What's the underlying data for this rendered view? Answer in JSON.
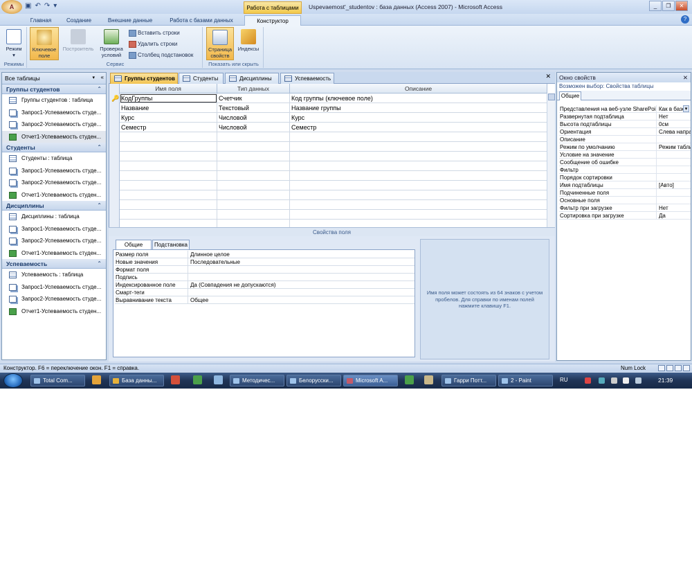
{
  "window": {
    "app_logo": "A",
    "title": "Uspevaemost'_studentov : база данных (Access 2007) - Microsoft Access",
    "context_tab": "Работа с таблицами",
    "buttons": [
      "_",
      "❐",
      "✕"
    ]
  },
  "ribbon_tabs": [
    "Главная",
    "Создание",
    "Внешние данные",
    "Работа с базами данных",
    "Конструктор"
  ],
  "ribbon": {
    "groups": {
      "modes": "Режимы",
      "service": "Сервис",
      "show_hide": "Показать или скрыть"
    },
    "mode_button": "Режим",
    "mode_arrow": "▾",
    "key_field": "Ключевое поле",
    "builder": "Построитель",
    "check_conditions": "Проверка условий",
    "insert_rows": "Вставить строки",
    "delete_rows": "Удалить строки",
    "lookup_column": "Столбец подстановок",
    "property_sheet": "Страница свойств",
    "indexes": "Индексы"
  },
  "nav": {
    "header": "Все таблицы",
    "groups": [
      {
        "title": "Группы студентов",
        "items": [
          {
            "label": "Группы студентов : таблица",
            "type": "table"
          },
          {
            "label": "Запрос1-Успеваемость студе...",
            "type": "query"
          },
          {
            "label": "Запрос2-Успеваемость студе...",
            "type": "query"
          },
          {
            "label": "Отчет1-Успеваемость студен...",
            "type": "report"
          }
        ]
      },
      {
        "title": "Студенты",
        "items": [
          {
            "label": "Студенты : таблица",
            "type": "table"
          },
          {
            "label": "Запрос1-Успеваемость студе...",
            "type": "query"
          },
          {
            "label": "Запрос2-Успеваемость студе...",
            "type": "query"
          },
          {
            "label": "Отчет1-Успеваемость студен...",
            "type": "report"
          }
        ]
      },
      {
        "title": "Дисциплины",
        "items": [
          {
            "label": "Дисциплины : таблица",
            "type": "table"
          },
          {
            "label": "Запрос1-Успеваемость студе...",
            "type": "query"
          },
          {
            "label": "Запрос2-Успеваемость студе...",
            "type": "query"
          },
          {
            "label": "Отчет1-Успеваемость студен...",
            "type": "report"
          }
        ]
      },
      {
        "title": "Успеваемость",
        "items": [
          {
            "label": "Успеваемость : таблица",
            "type": "table"
          },
          {
            "label": "Запрос1-Успеваемость студе...",
            "type": "query"
          },
          {
            "label": "Запрос2-Успеваемость студе...",
            "type": "query"
          },
          {
            "label": "Отчет1-Успеваемость студен...",
            "type": "report"
          }
        ]
      }
    ]
  },
  "doc_tabs": [
    "Группы студентов",
    "Студенты",
    "Дисциплины",
    "Успеваемость"
  ],
  "design_grid": {
    "headers": [
      "Имя поля",
      "Тип данных",
      "Описание"
    ],
    "rows": [
      [
        "КодГруппы",
        "Счетчик",
        "Код группы (ключевое поле)"
      ],
      [
        "Название",
        "Текстовый",
        "Название группы"
      ],
      [
        "Курс",
        "Числовой",
        "Курс"
      ],
      [
        "Семестр",
        "Числовой",
        "Семестр"
      ]
    ]
  },
  "field_props": {
    "section_title": "Свойства поля",
    "tabs": [
      "Общие",
      "Подстановка"
    ],
    "rows": [
      [
        "Размер поля",
        "Длинное целое"
      ],
      [
        "Новые значения",
        "Последовательные"
      ],
      [
        "Формат поля",
        ""
      ],
      [
        "Подпись",
        ""
      ],
      [
        "Индексированное поле",
        "Да (Совпадения не допускаются)"
      ],
      [
        "Смарт-теги",
        ""
      ],
      [
        "Выравнивание текста",
        "Общее"
      ]
    ],
    "help": "Имя поля может состоять из 64 знаков с учетом пробелов.  Для справки по именам полей нажмите клавишу F1."
  },
  "property_sheet": {
    "title": "Окно свойств",
    "selection": "Возможен выбор:  Свойства таблицы",
    "tab": "Общие",
    "rows": [
      [
        "Представления на веб-узле SharePoint",
        "Как в базе"
      ],
      [
        "Развернутая подтаблица",
        "Нет"
      ],
      [
        "Высота подтаблицы",
        "0см"
      ],
      [
        "Ориентация",
        "Слева направо"
      ],
      [
        "Описание",
        ""
      ],
      [
        "Режим по умолчанию",
        "Режим таблицы"
      ],
      [
        "Условие на значение",
        ""
      ],
      [
        "Сообщение об ошибке",
        ""
      ],
      [
        "Фильтр",
        ""
      ],
      [
        "Порядок сортировки",
        ""
      ],
      [
        "Имя подтаблицы",
        "[Авто]"
      ],
      [
        "Подчиненные поля",
        ""
      ],
      [
        "Основные поля",
        ""
      ],
      [
        "Фильтр при загрузке",
        "Нет"
      ],
      [
        "Сортировка при загрузке",
        "Да"
      ]
    ]
  },
  "status": {
    "text": "Конструктор.  F6 = переключение окон.  F1 = справка.",
    "num_lock": "Num Lock"
  },
  "taskbar": {
    "buttons": [
      "Total Com...",
      "База данны...",
      "Методичес...",
      "Белорусски...",
      "Microsoft A...",
      "Гарри Потт...",
      "2 - Paint"
    ],
    "lang": "RU",
    "clock": "21:39"
  }
}
